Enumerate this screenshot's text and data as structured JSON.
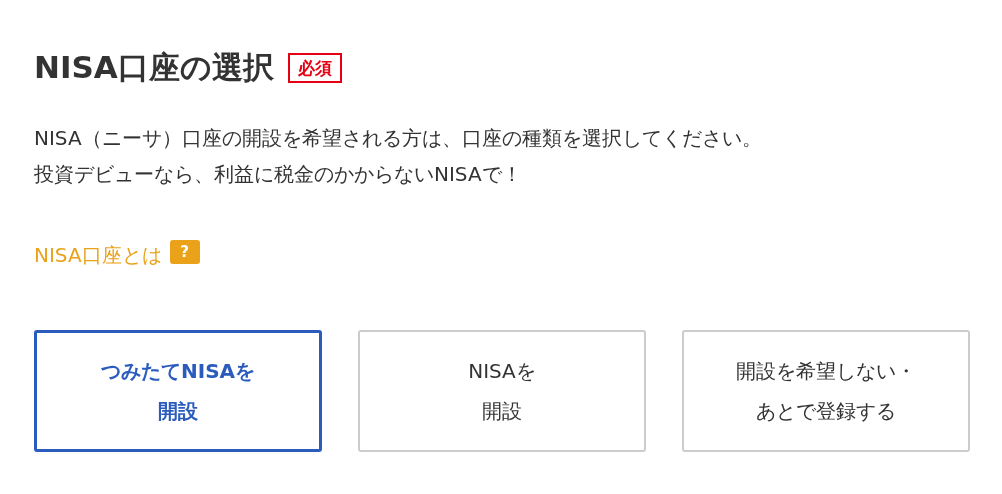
{
  "title": "NISA口座の選択",
  "required_badge": "必須",
  "description": [
    "NISA（ニーサ）口座の開設を希望される方は、口座の種類を選択してください。",
    "投資デビューなら、利益に税金のかからないNISAで！"
  ],
  "help_link": "NISA口座とは",
  "help_icon": "?",
  "options": [
    {
      "lines": [
        "つみたてNISAを",
        "開設"
      ],
      "selected": true
    },
    {
      "lines": [
        "NISAを",
        "開設"
      ],
      "selected": false
    },
    {
      "lines": [
        "開設を希望しない・",
        "あとで登録する"
      ],
      "selected": false
    }
  ]
}
